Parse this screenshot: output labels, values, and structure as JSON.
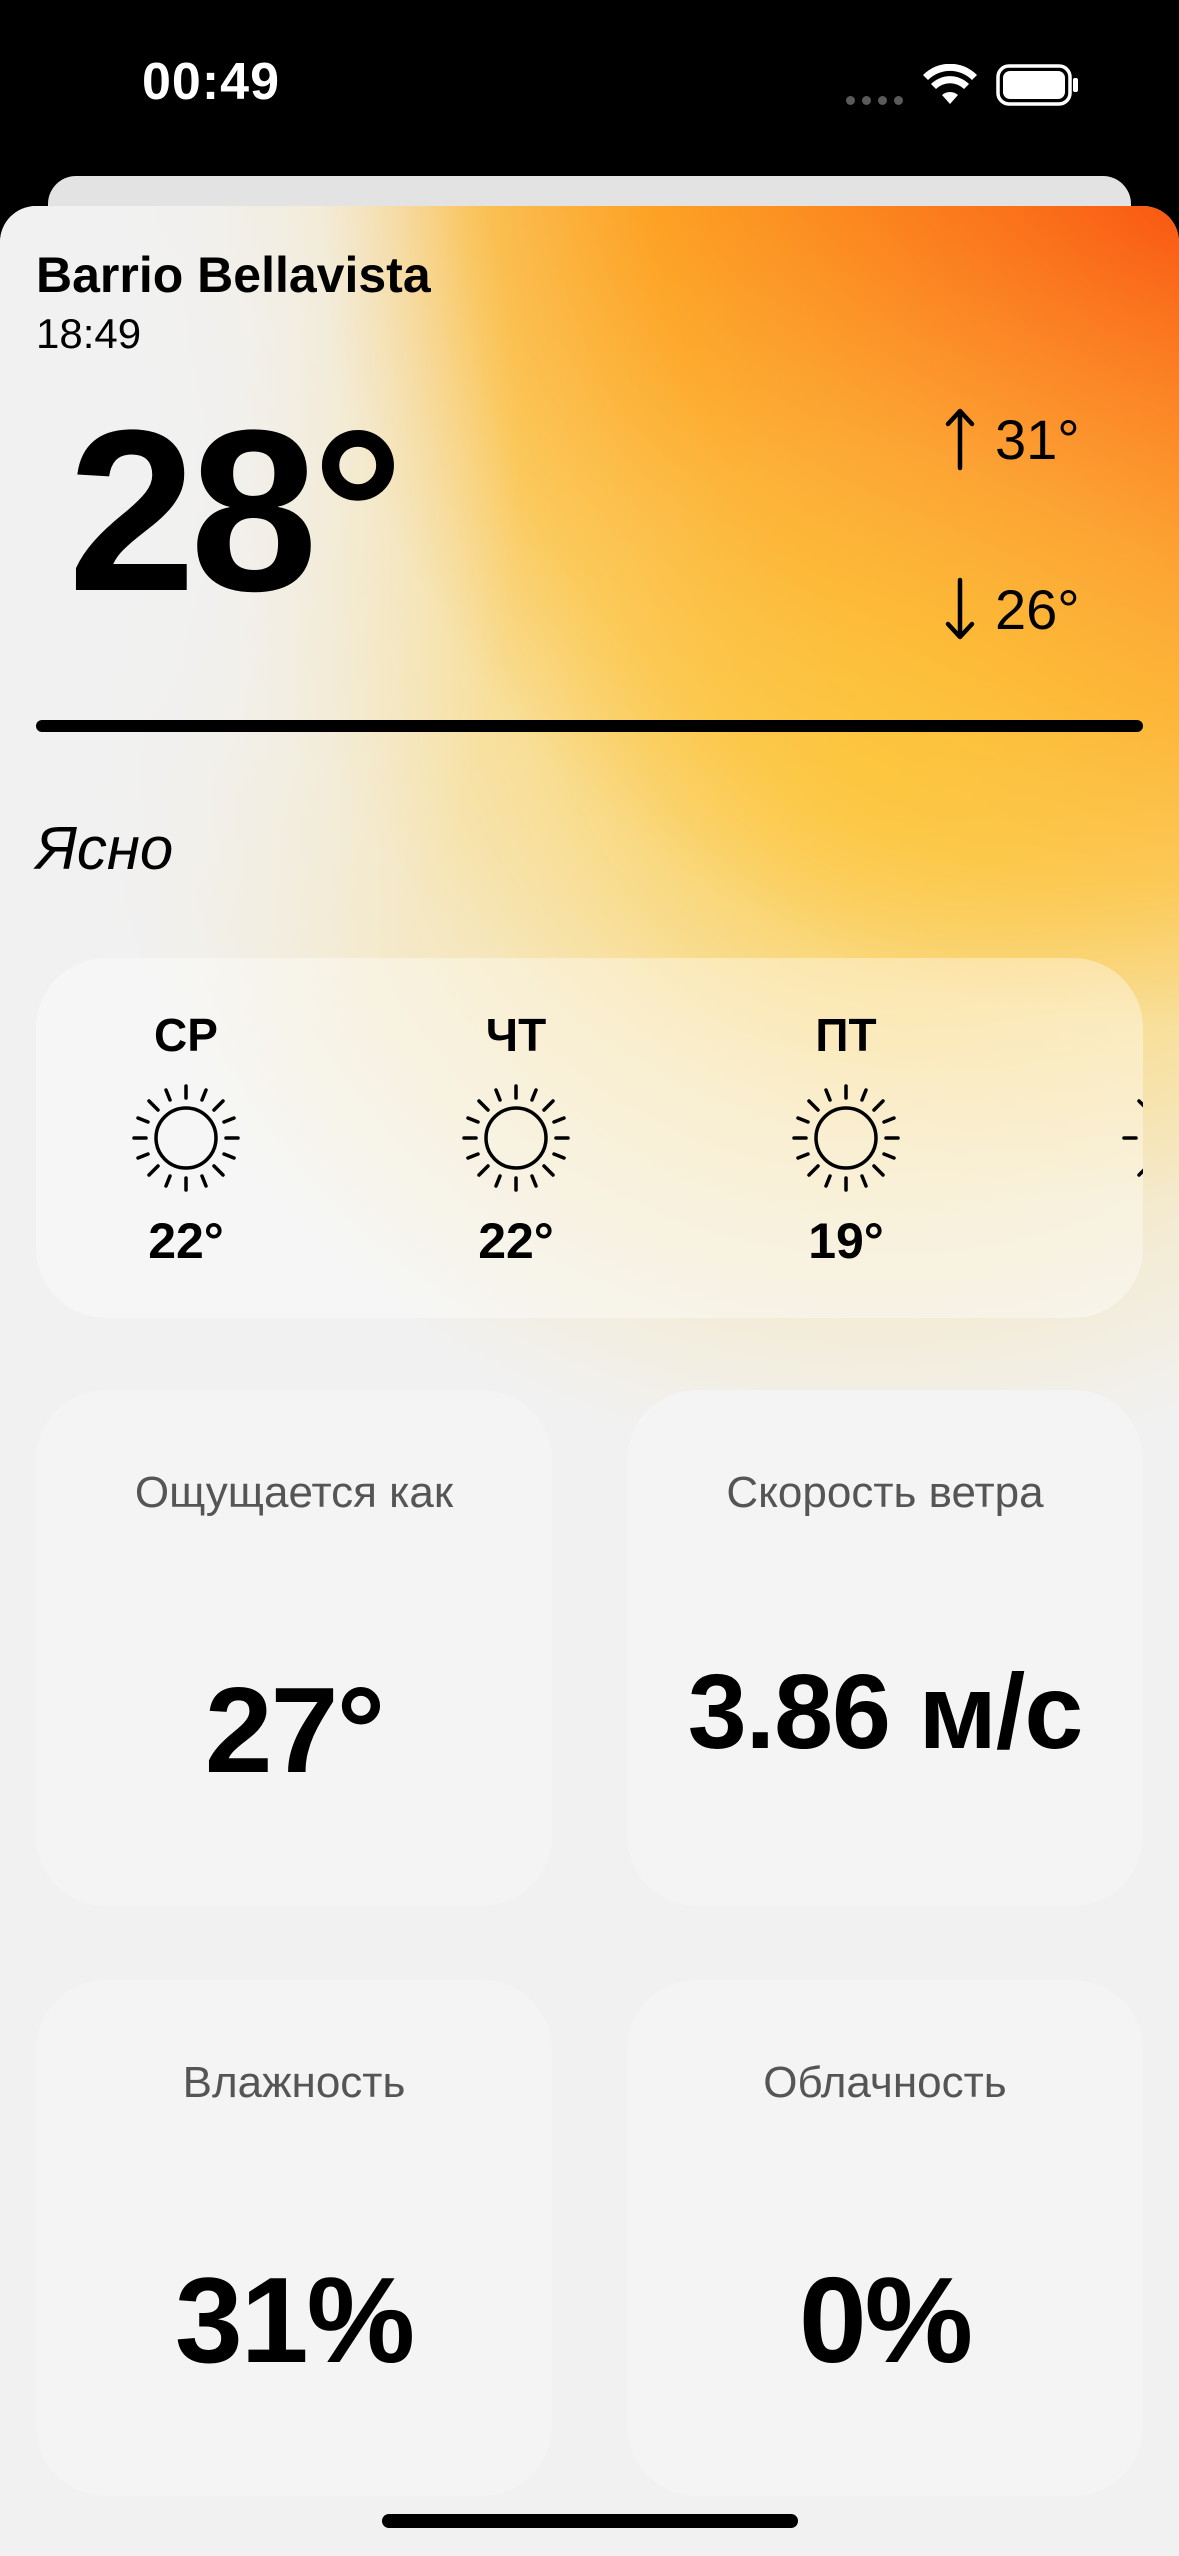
{
  "status_bar": {
    "time": "00:49"
  },
  "weather": {
    "location": "Barrio Bellavista",
    "local_time": "18:49",
    "current_temp": "28°",
    "high": "31°",
    "low": "26°",
    "condition": "Ясно"
  },
  "forecast": [
    {
      "day": "СР",
      "temp": "22°",
      "icon": "sun-icon"
    },
    {
      "day": "ЧТ",
      "temp": "22°",
      "icon": "sun-icon"
    },
    {
      "day": "ПТ",
      "temp": "19°",
      "icon": "sun-icon"
    }
  ],
  "cards": {
    "feels_like": {
      "label": "Ощущается как",
      "value": "27°"
    },
    "wind_speed": {
      "label": "Скорость ветра",
      "value": "3.86 м/с"
    },
    "humidity": {
      "label": "Влажность",
      "value": "31%"
    },
    "cloudiness": {
      "label": "Облачность",
      "value": "0%"
    }
  },
  "colors": {
    "accent_orange": "#f94a0b",
    "accent_yellow": "#fdb428",
    "card_bg": "#f4f4f4",
    "background": "#f1f1f1"
  }
}
